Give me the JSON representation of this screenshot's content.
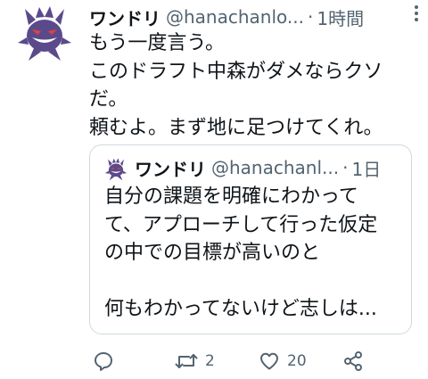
{
  "tweet": {
    "author": {
      "display_name": "ワンドリ",
      "handle": "@hanachanlo...",
      "avatar_icon": "gengar-avatar-icon"
    },
    "separator": "·",
    "time": "1時間",
    "text_lines": [
      "もう一度言う。",
      "このドラフト中森がダメならクソ",
      "だ。",
      "頼むよ。まず地に足つけてくれ。"
    ],
    "quote": {
      "author": {
        "display_name": "ワンドリ",
        "handle": "@hanachanl...",
        "avatar_icon": "gengar-avatar-icon"
      },
      "separator": "·",
      "time": "1日",
      "text_lines": [
        "自分の課題を明確にわかって",
        "て、アプローチして行った仮定",
        "の中での目標が高いのと",
        "",
        "何もわかってないけど志しは..."
      ]
    },
    "actions": {
      "reply_icon": "reply-icon",
      "retweet_icon": "retweet-icon",
      "retweet_count": "2",
      "like_icon": "heart-icon",
      "like_count": "20",
      "share_icon": "share-icon"
    },
    "colors": {
      "secondary_text": "#536471",
      "border": "#cfd9de",
      "gengar_purple": "#5b4a8b"
    }
  }
}
